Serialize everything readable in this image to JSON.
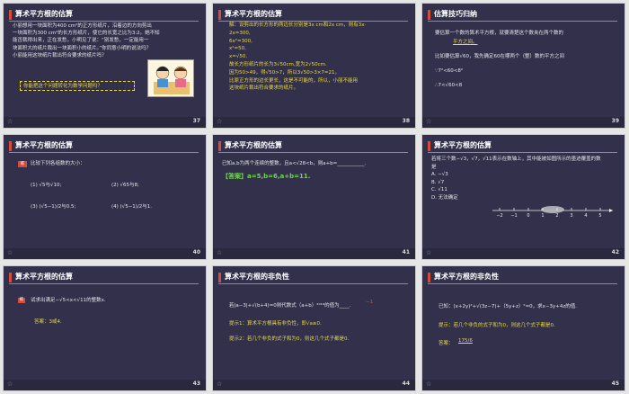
{
  "slides": [
    {
      "title": "算术平方根的估算",
      "num": "37",
      "lines": [
        "小丽想用一块面积为400 cm²的正方形纸片，沿着边的方向剪出",
        "一块面积为300 cm²的长方形纸片，使它的长宽之比为3:2。她不知",
        "能否裁得出来，正在发愁，小明见了说：“别发愁，一定能用一",
        "块面积大的纸片裁出一块面积小的纸片。”你同意小明的说法吗？",
        "小丽能用这块纸片裁出符合要求的纸片吗？"
      ],
      "question": "你能把这个问题转化为数学问题吗？"
    },
    {
      "title": "算术平方根的估算",
      "num": "38",
      "lines": [
        "解：设剪出的长方形的两边长分别是3x cm和2x cm，则有3x·",
        "2x=300,",
        "6x²=300,",
        "x²=50,",
        "x=√50.",
        "故长方形纸片的长为3√50cm,宽为2√50cm.",
        "因为50>49，得√50>7，所以3√50>3×7=21，",
        "比原正方形的边长更长，这是不可能的，所以，小丽不能用",
        "这块纸片裁出符合要求的纸片。"
      ]
    },
    {
      "title": "估算技巧归纳",
      "num": "39",
      "lines": [
        "要估算一个数的算术平方根，就要清楚这个数夹在两个数的",
        "平方之间。",
        "比如要估算√60，我先确定60在哪两个（整）数的平方之间",
        "∵7²<60<8²",
        "∴7<√60<8"
      ]
    },
    {
      "title": "算术平方根的估算",
      "num": "40",
      "label": "练",
      "lines": [
        "比较下列各组数的大小：",
        "(1) √5与√10;",
        "(2) √65与8;",
        "(3) (√5−1)/2与0.5;",
        "(4) (√5−1)/2与1."
      ]
    },
    {
      "title": "算术平方根的估算",
      "num": "41",
      "lines": [
        "已知a,b为两个连续的整数，且a<√28<b，则a+b=___________.",
        "【答案】a=5,b=6,a+b=11."
      ]
    },
    {
      "title": "算术平方根的估算",
      "num": "42",
      "lines": [
        "若将三个数−√3，√7，√11表示在数轴上，其中能被如图所示的墨迹覆盖的数",
        "是",
        "A. −√3",
        "B. √7",
        "C. √11",
        "D. 无法确定"
      ],
      "ticks": [
        "−2",
        "−1",
        "0",
        "1",
        "2",
        "3",
        "4",
        "5"
      ]
    },
    {
      "title": "算术平方根的估算",
      "num": "43",
      "label": "练",
      "lines": [
        "试求出满足−√5<x<√11的整数x.",
        "答案：3或4."
      ]
    },
    {
      "title": "算术平方根的非负性",
      "num": "44",
      "lines": [
        "若|a−3|+√(b+4)=0则代数式（a+b）²⁰¹⁶的值为____.",
        "−1",
        "提示1：算术平方根具有非负性，即√a≥0.",
        "提示2：若几个非负的式子和为0，则这几个式子都是0."
      ]
    },
    {
      "title": "算术平方根的非负性",
      "num": "45",
      "lines": [
        "已知：(x+2y)²+√(3z−7)+（5y+z）²=0，求x−3y+4z的值.",
        "提示：若几个非负的式子和为0，则这几个式子都是0.",
        "答案：",
        "175/6"
      ]
    }
  ],
  "footer_star": "☆"
}
